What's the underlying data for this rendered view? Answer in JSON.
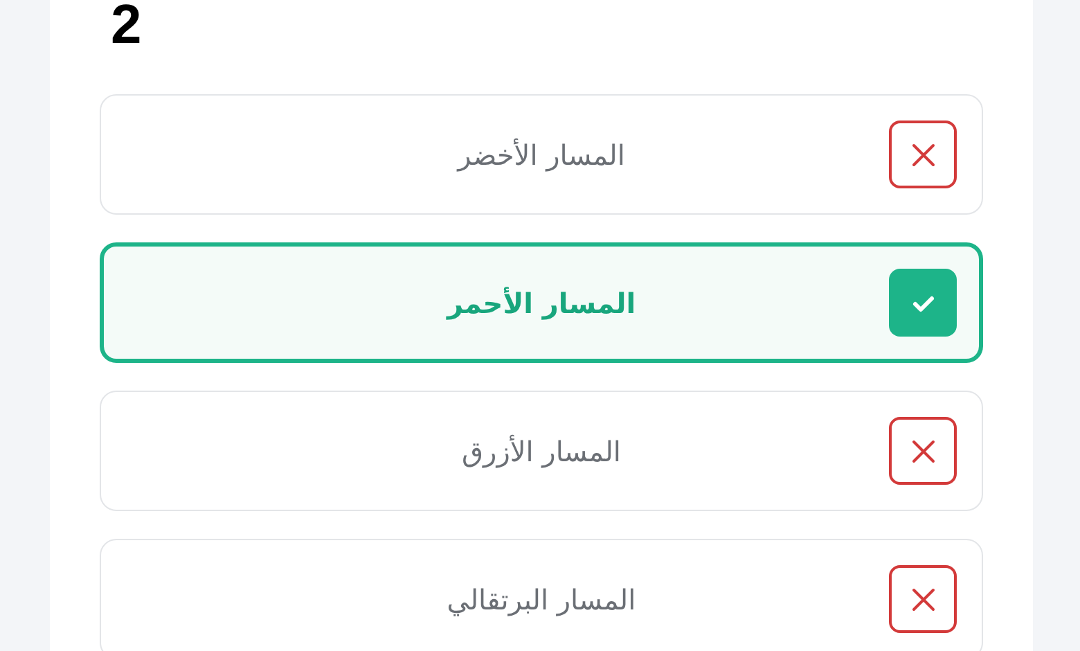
{
  "question_number": "2",
  "options": [
    {
      "label": "المسار الأخضر",
      "selected": false
    },
    {
      "label": "المسار الأحمر",
      "selected": true
    },
    {
      "label": "المسار الأزرق",
      "selected": false
    },
    {
      "label": "المسار البرتقالي",
      "selected": false
    }
  ]
}
